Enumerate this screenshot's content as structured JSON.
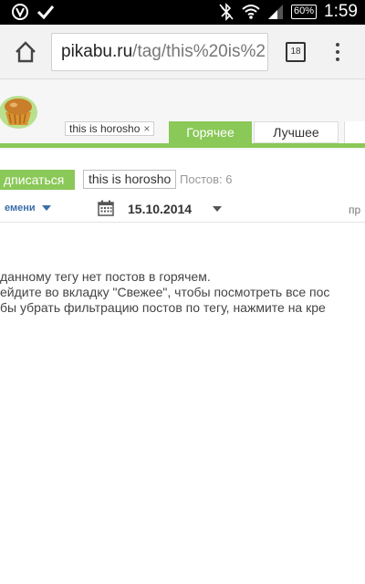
{
  "status_bar": {
    "battery": "60%",
    "time": "1:59"
  },
  "browser": {
    "url_host": "pikabu.ru",
    "url_path": "/tag/this%20is%2",
    "tab_count": "18"
  },
  "header": {
    "tag_chip": "this is horosho",
    "tag_chip_close": "×",
    "tabs": [
      {
        "label": "Горячее",
        "active": true
      },
      {
        "label": "Лучшее",
        "active": false
      }
    ],
    "accent_color": "#8ac858"
  },
  "tag_bar": {
    "subscribe_label": "дписаться",
    "tag_name": "this is horosho",
    "posts_count": "Постов: 6"
  },
  "filters": {
    "sort_label": "емени",
    "date": "15.10.2014",
    "right_label": "пр"
  },
  "message": {
    "line1": "данному тегу нет постов в горячем.",
    "line2": "ейдите во вкладку \"Свежее\", чтобы посмотреть все пос",
    "line3": "бы убрать фильтрацию постов по тегу, нажмите на кре"
  }
}
